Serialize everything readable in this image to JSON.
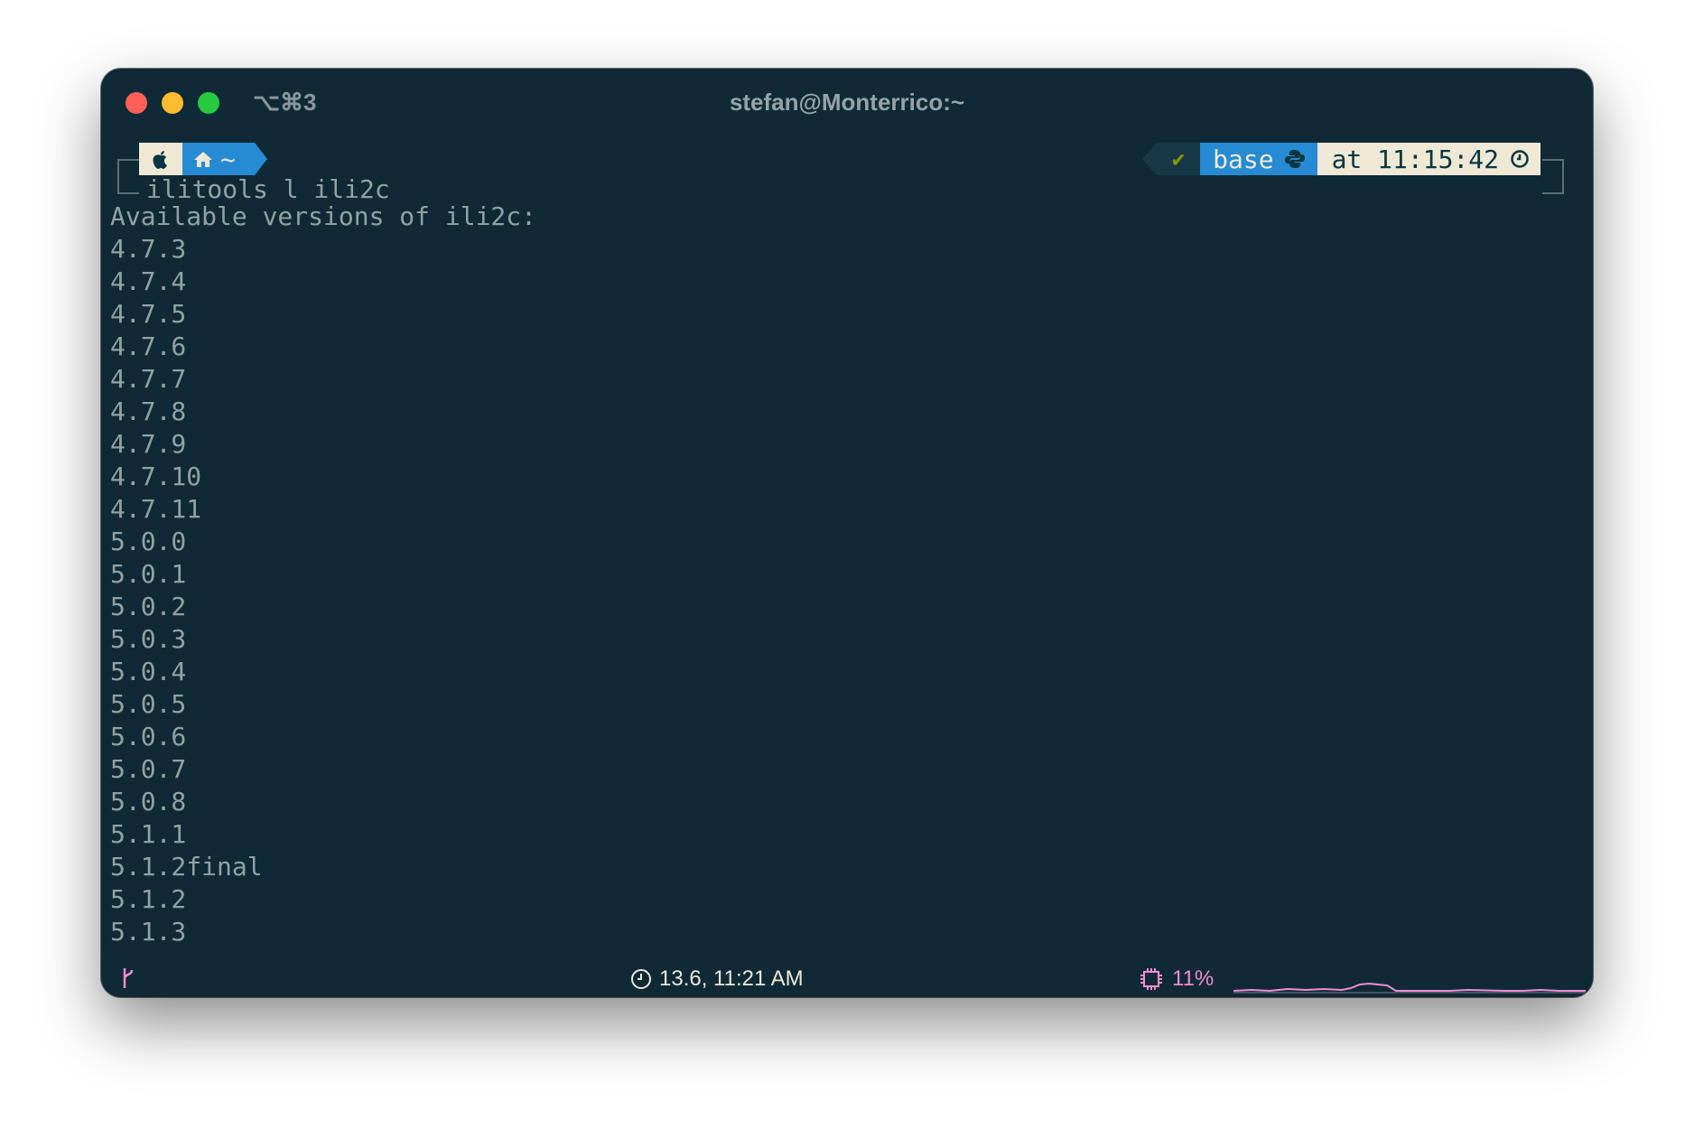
{
  "window": {
    "shortcut": "⌥⌘3",
    "title": "stefan@Monterrico:~"
  },
  "prompt": {
    "dir": "~",
    "status_check": "✔",
    "env": "base",
    "time": "at 11:15:42",
    "command": "ilitools l ili2c"
  },
  "output": {
    "header": "Available versions of ili2c:",
    "versions": [
      "4.7.3",
      "4.7.4",
      "4.7.5",
      "4.7.6",
      "4.7.7",
      "4.7.8",
      "4.7.9",
      "4.7.10",
      "4.7.11",
      "5.0.0",
      "5.0.1",
      "5.0.2",
      "5.0.3",
      "5.0.4",
      "5.0.5",
      "5.0.6",
      "5.0.7",
      "5.0.8",
      "5.1.1",
      "5.1.2final",
      "5.1.2",
      "5.1.3"
    ]
  },
  "statusbar": {
    "datetime": "13.6, 11:21 AM",
    "cpu": "11%"
  },
  "colors": {
    "background": "#0f2a36",
    "text": "#93a1a1",
    "blue": "#268bd2",
    "cream": "#eee8d5",
    "green": "#859900",
    "pink": "#f28cd3"
  },
  "icons": [
    "apple-icon",
    "home-icon",
    "check-icon",
    "python-icon",
    "clock-icon",
    "branch-icon",
    "cpu-icon"
  ]
}
